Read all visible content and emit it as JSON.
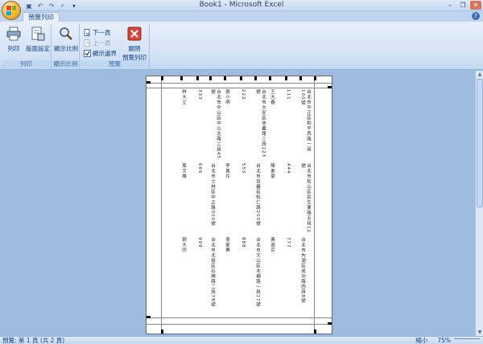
{
  "window": {
    "title": "Book1 - Microsoft Excel"
  },
  "qat": {
    "icons": [
      "save-icon",
      "undo-icon",
      "redo-icon",
      "zoom-icon",
      "customize-icon"
    ]
  },
  "tabs": [
    {
      "label": "預覽列印",
      "active": true
    }
  ],
  "ribbon": {
    "groups": [
      {
        "label": "列印",
        "buttons": [
          {
            "label": "列印",
            "icon": "printer-icon"
          },
          {
            "label": "版面設定",
            "icon": "page-setup-icon"
          }
        ]
      },
      {
        "label": "顯示比例",
        "buttons": [
          {
            "label": "顯示比例",
            "icon": "zoom-magnifier-icon"
          }
        ]
      },
      {
        "label": "預覽",
        "small_buttons": [
          {
            "label": "下一頁",
            "enabled": true
          },
          {
            "label": "上一頁",
            "enabled": false
          },
          {
            "label": "顯示邊界",
            "checked": true
          }
        ],
        "close_button": {
          "line1": "關閉",
          "line2": "預覽列印"
        }
      }
    ]
  },
  "page": {
    "col_a": [
      "王大春",
      "張小明",
      "林大立",
      "陳家豪",
      "李美玲",
      "周文雄",
      "黃淑芬",
      "吳家興",
      "劉大同"
    ],
    "col_b": [
      "111",
      "222",
      "333",
      "444",
      "555",
      "666",
      "777",
      "888",
      "999"
    ],
    "col_c": [
      "台北市中正區和平西路一段100號",
      "台北市大安區信義路三段123號",
      "台北市中山區中山北路二段45號",
      "台北市松山區民生東路五段12號",
      "台北市信義區松仁路200號",
      "台北市士林區中正路300號",
      "台北市內湖區成功路四段8號",
      "台北市文山區木柵路一段17號",
      "台北市北投區石牌路二段78號"
    ]
  },
  "status": {
    "left": "預覽: 第 1 頁 (共 2 頁)",
    "zoom_label": "縮小",
    "zoom_value": "75%"
  },
  "colors": {
    "ribbon_text": "#15428b",
    "workspace": "#9ebbe0",
    "close_red": "#d9473a"
  }
}
